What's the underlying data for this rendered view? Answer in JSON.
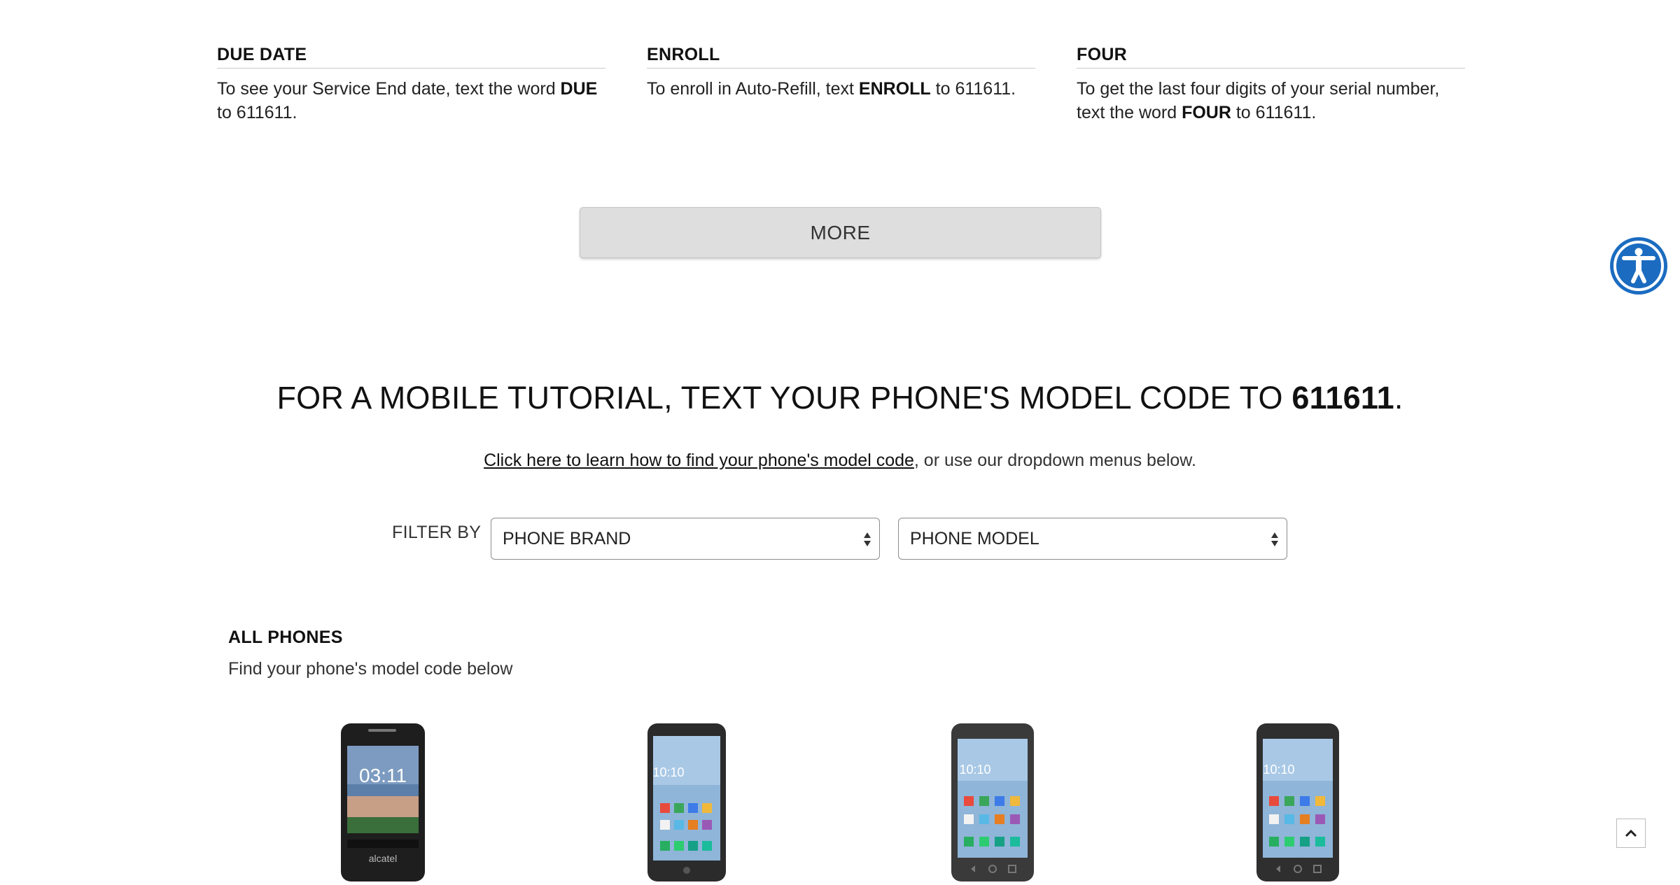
{
  "info_columns": [
    {
      "title": "DUE DATE",
      "text_before": "To see your Service End date, text the word ",
      "keyword": "DUE",
      "text_after": " to 611611."
    },
    {
      "title": "ENROLL",
      "text_before": "To enroll in Auto-Refill, text ",
      "keyword": "ENROLL",
      "text_after": " to 611611."
    },
    {
      "title": "FOUR",
      "text_before": "To get the last four digits of your serial number, text the word ",
      "keyword": "FOUR",
      "text_after": " to 611611."
    }
  ],
  "more_button_label": "MORE",
  "tutorial": {
    "title_prefix": "FOR A MOBILE TUTORIAL, TEXT YOUR PHONE'S MODEL CODE TO ",
    "title_number": "611611",
    "title_suffix": ".",
    "help_link": "Click here to learn how to find your phone's model code",
    "help_rest": ", or use our dropdown menus below."
  },
  "filter": {
    "label": "FILTER BY",
    "brand_selected": "PHONE BRAND",
    "model_selected": "PHONE MODEL"
  },
  "phones_section": {
    "heading": "ALL PHONES",
    "subheading": "Find your phone's model code below"
  },
  "phones": [
    {
      "screen_time": "03:11",
      "brand_text": "alcatel"
    },
    {
      "screen_time": "10:10"
    },
    {
      "screen_time": "10:10"
    },
    {
      "screen_time": "10:10"
    }
  ],
  "colors": {
    "accessibility_button": "#1b6cc0",
    "more_button_bg": "#dedede"
  },
  "icons": {
    "accessibility": "accessibility-person-icon",
    "scroll_top": "chevron-up-icon",
    "select_arrows": "updown-arrows-icon"
  }
}
